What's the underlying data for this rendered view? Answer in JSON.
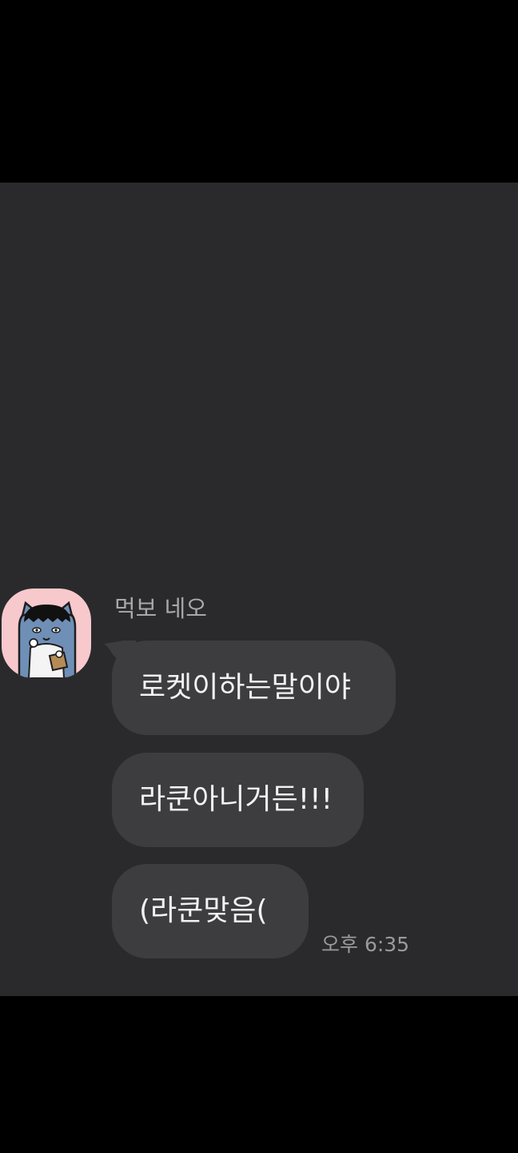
{
  "chat": {
    "sender": {
      "name": "먹보 네오",
      "avatar_icon": "neo-cat-character-icon",
      "avatar_bg": "#f7c9cc"
    },
    "messages": [
      {
        "text": "로켓이하는말이야"
      },
      {
        "text": "라쿤아니거든!!!"
      },
      {
        "text": "(라쿤맞음("
      }
    ],
    "timestamp": "오후 6:35"
  },
  "colors": {
    "background": "#2a2a2c",
    "bubble": "#3d3d3f",
    "message_text": "#f2f2f2",
    "name_text": "#a8a8a8",
    "time_text": "#9a9a9a",
    "letterbox": "#000000"
  }
}
